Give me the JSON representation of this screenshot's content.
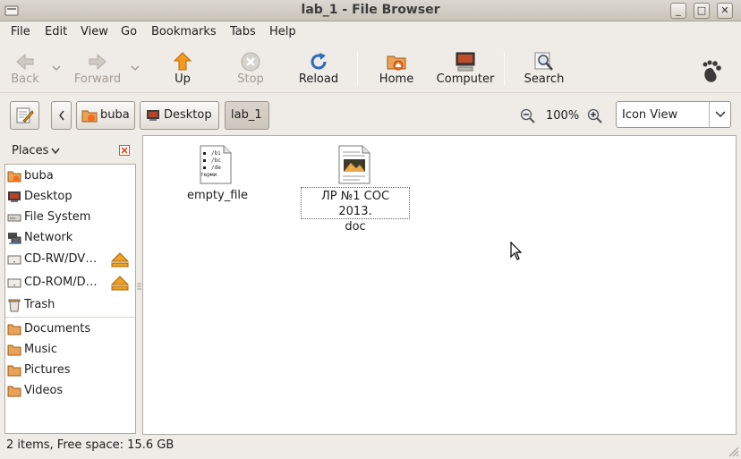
{
  "window": {
    "title": "lab_1 - File Browser",
    "minimize": "_",
    "maximize": "□",
    "close": "✕"
  },
  "menu": [
    {
      "label": "File"
    },
    {
      "label": "Edit"
    },
    {
      "label": "View"
    },
    {
      "label": "Go"
    },
    {
      "label": "Bookmarks"
    },
    {
      "label": "Tabs"
    },
    {
      "label": "Help"
    }
  ],
  "toolbar": {
    "back": "Back",
    "forward": "Forward",
    "up": "Up",
    "stop": "Stop",
    "reload": "Reload",
    "home": "Home",
    "computer": "Computer",
    "search": "Search"
  },
  "location": {
    "path": [
      "buba",
      "Desktop",
      "lab_1"
    ],
    "zoom": "100%",
    "view_mode": "Icon View"
  },
  "sidebar": {
    "header": "Places",
    "places": [
      {
        "label": "buba",
        "icon": "home-folder-icon"
      },
      {
        "label": "Desktop",
        "icon": "desktop-icon"
      },
      {
        "label": "File System",
        "icon": "drive-icon"
      },
      {
        "label": "Network",
        "icon": "network-icon"
      },
      {
        "label": "CD-RW/DV…",
        "icon": "optical-drive-icon"
      },
      {
        "label": "CD-ROM/D…",
        "icon": "optical-drive-icon"
      },
      {
        "label": "Trash",
        "icon": "trash-icon"
      }
    ],
    "bookmarks": [
      {
        "label": "Documents",
        "icon": "folder-icon"
      },
      {
        "label": "Music",
        "icon": "folder-icon"
      },
      {
        "label": "Pictures",
        "icon": "folder-icon"
      },
      {
        "label": "Videos",
        "icon": "folder-icon"
      }
    ]
  },
  "files": [
    {
      "name": "empty_file",
      "icon": "script-file-icon",
      "preview_lines": [
        "/bi",
        "/bc",
        "/de",
        "терми"
      ]
    },
    {
      "name_line1": "ЛР №1 СОС 2013.",
      "name_line2": "doc",
      "icon": "document-file-icon"
    }
  ],
  "status": "2 items, Free space: 15.6 GB"
}
